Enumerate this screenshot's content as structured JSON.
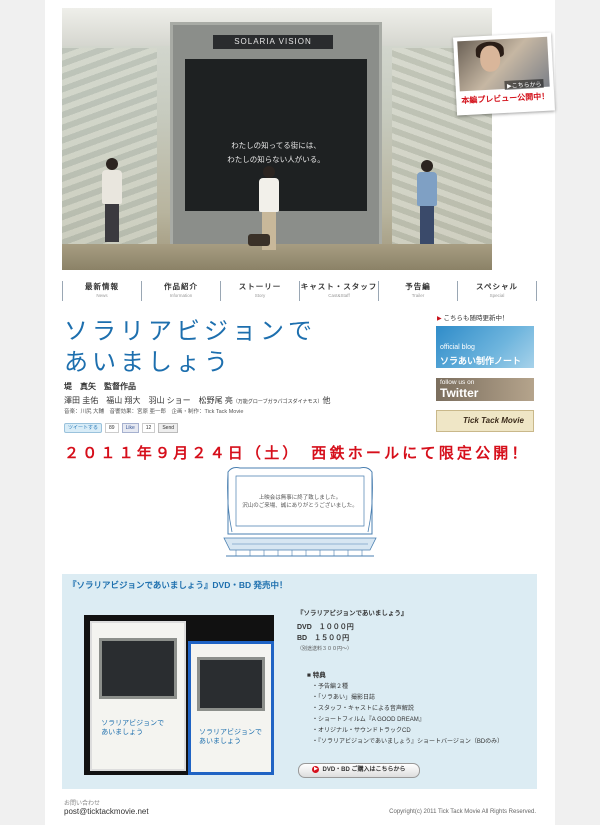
{
  "hero": {
    "screen_brand": "SOLARIA VISION",
    "screen_caption_1": "わたしの知ってる街には、",
    "screen_caption_2": "わたしの知らない人がいる。"
  },
  "preview": {
    "link": "▶こちらから",
    "label": "本編プレビュー公開中！"
  },
  "nav": [
    {
      "jp": "最新情報",
      "en": "News"
    },
    {
      "jp": "作品紹介",
      "en": "Information"
    },
    {
      "jp": "ストーリー",
      "en": "Story"
    },
    {
      "jp": "キャスト・スタッフ",
      "en": "Cast&Staff"
    },
    {
      "jp": "予告編",
      "en": "Trailer"
    },
    {
      "jp": "スペシャル",
      "en": "Special"
    }
  ],
  "title": {
    "line1": "ソラリアビジョンで",
    "line2": "あいましょう"
  },
  "credits": {
    "director": "堤　真矢　監督作品",
    "cast_main": "澤田 圭佑　福山 翔大　羽山 ショー　松野尾 亮",
    "cast_note": "（万能グローブガラパゴスダイナモス）",
    "cast_end": "他",
    "staff": "音楽：川尻 大輔　音響効果：宮原 亜一郎　企画・制作：Tick Tack Movie"
  },
  "social": {
    "tweet": "ツイートする",
    "tweet_count": "89",
    "like": "Like",
    "like_count": "12",
    "send": "Send"
  },
  "sidebar": {
    "label": "こちらも随時更新中！",
    "blog_en": "official blog",
    "blog_jp": "ソラあい制作ノート",
    "twitter_a": "follow us on",
    "twitter_b": "Twitter",
    "tick": "Tick Tack Movie"
  },
  "release": "２０１１年９月２４日（土）　西鉄ホールにて限定公開！",
  "theater": {
    "msg1": "上映会は無事に終了致しました。",
    "msg2": "沢山のご来場、誠にありがとうございました。"
  },
  "dvd": {
    "heading": "『ソラリアビジョンであいましょう』DVD・BD 発売中！",
    "case_title_1": "ソラリアビジョンで",
    "case_title_2": "あいましょう",
    "info_title": "『ソラリアビジョンであいましょう』",
    "price_dvd": "DVD　１０００円",
    "price_bd": "BD　１５００円",
    "shipping": "（別途送料３００円〜）",
    "bonus_title": "■ 特典",
    "bonus": [
      "・予告編２種",
      "・「ソラあい」撮影日誌",
      "・スタッフ・キャストによる音声解説",
      "・ショートフィルム『A GOOD DREAM』",
      "・オリジナル・サウンドトラックCD",
      "・『ソラリアビジョンであいましょう』ショートバージョン（BDのみ）"
    ],
    "buy_button": "DVD・BD ご購入はこちらから"
  },
  "footer": {
    "contact_label": "お問い合わせ",
    "email": "post@ticktackmovie.net",
    "copyright": "Copyright(c) 2011 Tick Tack Movie All Rights Reserved."
  }
}
